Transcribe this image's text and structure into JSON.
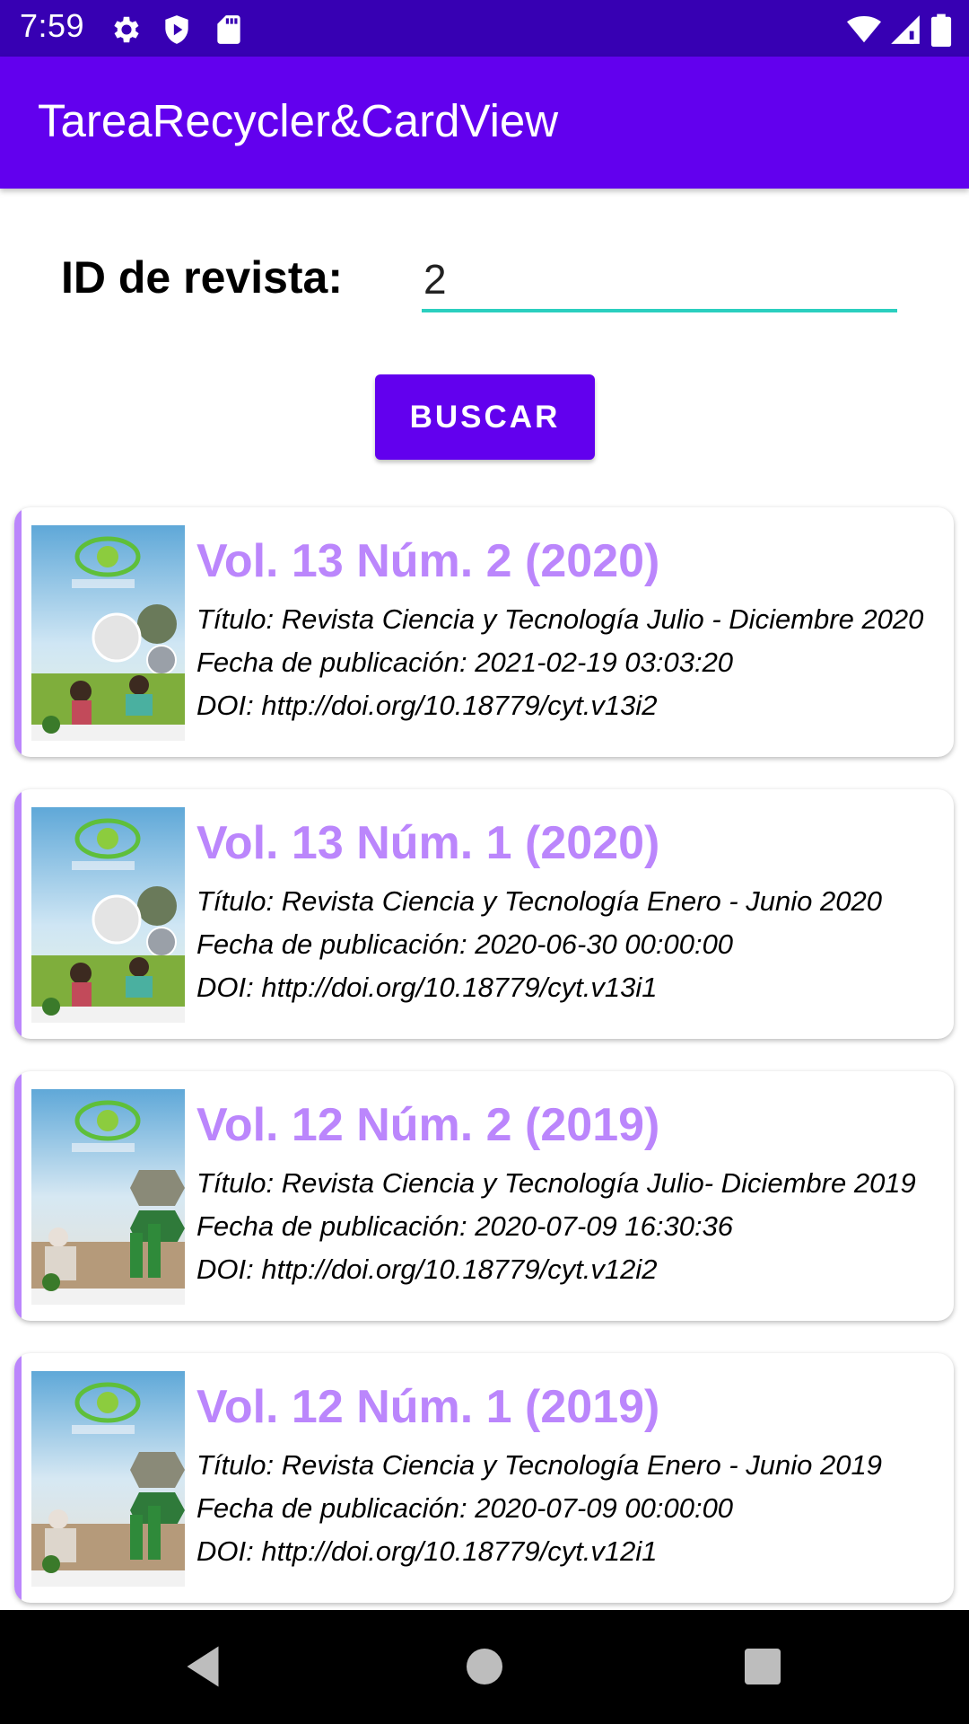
{
  "status_bar": {
    "time": "7:59",
    "left_icons": [
      "gear-icon",
      "shield-play-icon",
      "sd-card-icon"
    ],
    "right_icons": [
      "wifi-icon",
      "cell-signal-icon",
      "battery-icon"
    ]
  },
  "app_bar": {
    "title": "TareaRecycler&CardView"
  },
  "search": {
    "label": "ID de revista:",
    "value": "2",
    "button_label": "BUSCAR"
  },
  "cards": [
    {
      "volume": "Vol. 13 Núm. 2 (2020)",
      "title_line": "Título: Revista Ciencia y Tecnología Julio - Diciembre 2020",
      "date_line": "Fecha de publicación: 2021-02-19 03:03:20",
      "doi_line": "DOI: http://doi.org/10.18779/cyt.v13i2"
    },
    {
      "volume": "Vol. 13 Núm. 1 (2020)",
      "title_line": "Título: Revista Ciencia y Tecnología Enero - Junio 2020",
      "date_line": "Fecha de publicación: 2020-06-30 00:00:00",
      "doi_line": "DOI: http://doi.org/10.18779/cyt.v13i1"
    },
    {
      "volume": "Vol. 12 Núm. 2 (2019)",
      "title_line": "Título: Revista Ciencia y Tecnología Julio- Diciembre 2019",
      "date_line": "Fecha de publicación: 2020-07-09 16:30:36",
      "doi_line": "DOI: http://doi.org/10.18779/cyt.v12i2"
    },
    {
      "volume": "Vol. 12 Núm. 1 (2019)",
      "title_line": "Título: Revista Ciencia y Tecnología Enero - Junio 2019",
      "date_line": "Fecha de publicación: 2020-07-09 00:00:00",
      "doi_line": "DOI: http://doi.org/10.18779/cyt.v12i1"
    }
  ],
  "nav_bar": {
    "icons": [
      "back-icon",
      "home-icon",
      "recents-icon"
    ]
  },
  "colors": {
    "status_bar": "#3700b3",
    "app_bar": "#6200ee",
    "accent_purple": "#bb86fc",
    "input_underline": "#2bcfbf"
  }
}
